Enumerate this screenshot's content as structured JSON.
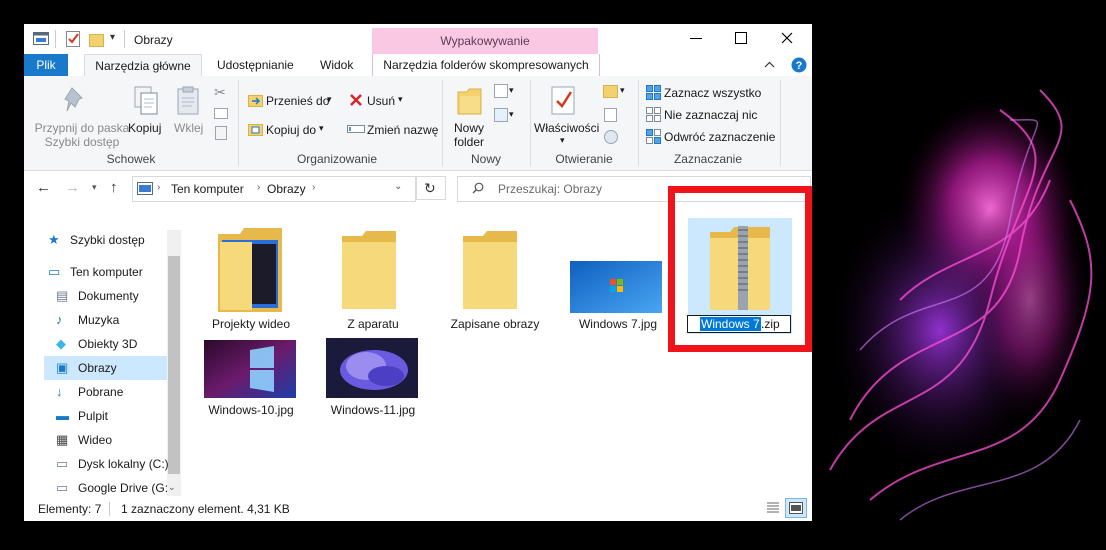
{
  "window": {
    "title": "Obrazy",
    "context_group": "Wypakowywanie"
  },
  "tabs": {
    "file": "Plik",
    "home": "Narzędzia główne",
    "share": "Udostępnianie",
    "view": "Widok",
    "compressed": "Narzędzia folderów skompresowanych"
  },
  "ribbon": {
    "clipboard": {
      "pin_line1": "Przypnij do paska",
      "pin_line2": "Szybki dostęp",
      "copy": "Kopiuj",
      "paste": "Wklej",
      "label": "Schowek"
    },
    "organize": {
      "move_to": "Przenieś do",
      "copy_to": "Kopiuj do",
      "delete": "Usuń",
      "rename": "Zmień nazwę",
      "label": "Organizowanie"
    },
    "new": {
      "new_folder_line1": "Nowy",
      "new_folder_line2": "folder",
      "label": "Nowy"
    },
    "open": {
      "properties": "Właściwości",
      "label": "Otwieranie"
    },
    "select": {
      "select_all": "Zaznacz wszystko",
      "select_none": "Nie zaznaczaj nic",
      "invert": "Odwróć zaznaczenie",
      "label": "Zaznaczanie"
    }
  },
  "address": {
    "crumb1": "Ten komputer",
    "crumb2": "Obrazy",
    "search_placeholder": "Przeszukaj: Obrazy"
  },
  "nav": [
    {
      "label": "Szybki dostęp",
      "icon": "star-icon"
    },
    {
      "label": "Ten komputer",
      "icon": "computer-icon"
    },
    {
      "label": "Dokumenty",
      "icon": "documents-icon"
    },
    {
      "label": "Muzyka",
      "icon": "music-icon"
    },
    {
      "label": "Obiekty 3D",
      "icon": "cube-icon"
    },
    {
      "label": "Obrazy",
      "icon": "pictures-icon"
    },
    {
      "label": "Pobrane",
      "icon": "download-icon"
    },
    {
      "label": "Pulpit",
      "icon": "desktop-icon"
    },
    {
      "label": "Wideo",
      "icon": "video-icon"
    },
    {
      "label": "Dysk lokalny (C:)",
      "icon": "drive-icon"
    },
    {
      "label": "Google Drive (G:",
      "icon": "drive-icon"
    }
  ],
  "files": [
    {
      "name": "Projekty wideo",
      "type": "folder-video"
    },
    {
      "name": "Z aparatu",
      "type": "folder"
    },
    {
      "name": "Zapisane obrazy",
      "type": "folder"
    },
    {
      "name": "Windows 7.jpg",
      "type": "image"
    },
    {
      "name_selected": "Windows 7",
      "name_rest": ".zip",
      "type": "zip"
    },
    {
      "name": "Windows-10.jpg",
      "type": "image"
    },
    {
      "name": "Windows-11.jpg",
      "type": "image"
    }
  ],
  "status": {
    "count": "Elementy: 7",
    "selection": "1 zaznaczony element. 4,31 KB"
  },
  "colors": {
    "accent": "#1979ca",
    "highlight_border": "#f1131a",
    "context_tab": "#fbc8e3",
    "selection": "#cce8ff"
  }
}
